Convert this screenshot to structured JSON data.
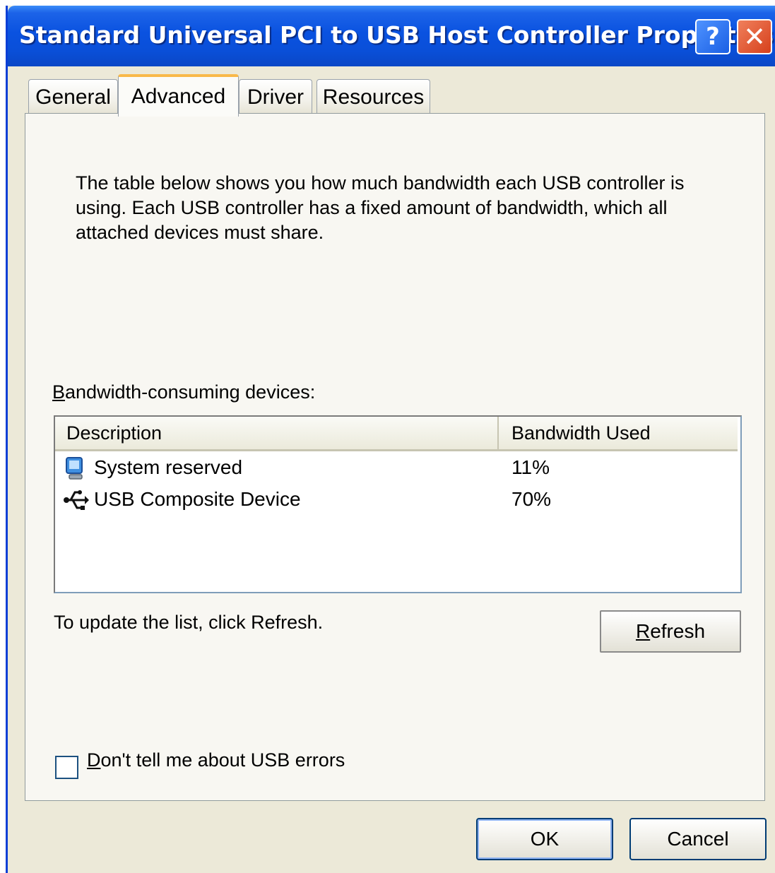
{
  "window": {
    "title": "Standard Universal PCI to USB Host Controller Properties",
    "help_glyph": "?",
    "close_glyph": "✕"
  },
  "tabs": [
    {
      "label": "General",
      "active": false
    },
    {
      "label": "Advanced",
      "active": true
    },
    {
      "label": "Driver",
      "active": false
    },
    {
      "label": "Resources",
      "active": false
    }
  ],
  "advanced": {
    "intro_text": "The table below shows you how much bandwidth each USB controller is using. Each USB controller has a fixed amount of bandwidth, which all attached devices must share.",
    "devices_label": "Bandwidth-consuming devices:",
    "columns": [
      "Description",
      "Bandwidth Used"
    ],
    "rows": [
      {
        "icon": "system-reserved-icon",
        "description": "System reserved",
        "bandwidth": "11%"
      },
      {
        "icon": "usb-icon",
        "description": "USB Composite Device",
        "bandwidth": "70%"
      }
    ],
    "update_hint": "To update the list, click Refresh.",
    "refresh_label": "Refresh",
    "checkbox_label": "Don't tell me about USB errors",
    "checkbox_checked": false
  },
  "footer": {
    "ok_label": "OK",
    "cancel_label": "Cancel"
  },
  "colors": {
    "titlebar": "#0a52e0",
    "dialog_bg": "#ece9d8",
    "active_tab_accent": "#f9b94a"
  }
}
